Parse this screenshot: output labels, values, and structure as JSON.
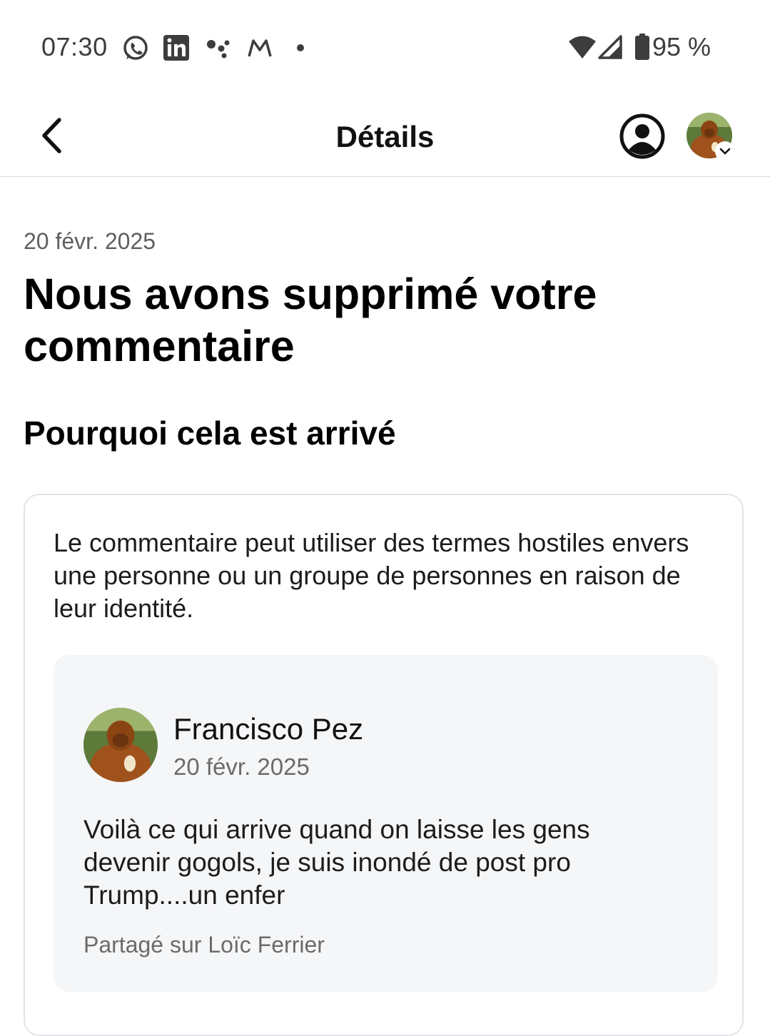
{
  "status_bar": {
    "time": "07:30",
    "notification_icons": [
      "whatsapp-icon",
      "linkedin-icon",
      "assistant-dots-icon",
      "gmail-icon",
      "more-notifications-dot-icon"
    ],
    "battery_percent": "95 %",
    "right_icons": [
      "wifi-icon",
      "cellular-signal-icon",
      "battery-icon"
    ]
  },
  "app_bar": {
    "title": "Détails",
    "back_icon": "chevron-left-icon",
    "profile_icon": "account-circle-icon",
    "avatar_menu_icon": "chevron-down-icon"
  },
  "notice": {
    "date": "20 févr. 2025",
    "headline": "Nous avons supprimé votre commentaire",
    "why_title": "Pourquoi cela est arrivé",
    "reason": "Le commentaire peut utiliser des termes hostiles envers une personne ou un groupe de personnes en raison de leur identité."
  },
  "comment": {
    "author": "Francisco Pez",
    "date": "20 févr. 2025",
    "text": "Voilà ce qui arrive quand on laisse les gens devenir gogols, je suis inondé de post pro Trump....un enfer",
    "shared_on": "Partagé sur Loïc Ferrier"
  },
  "colors": {
    "text_primary": "#000000",
    "text_secondary": "#6b6b6b",
    "card_border": "#e3e4e8",
    "comment_bg": "#f5f6f8",
    "divider": "#dcdcdc"
  }
}
